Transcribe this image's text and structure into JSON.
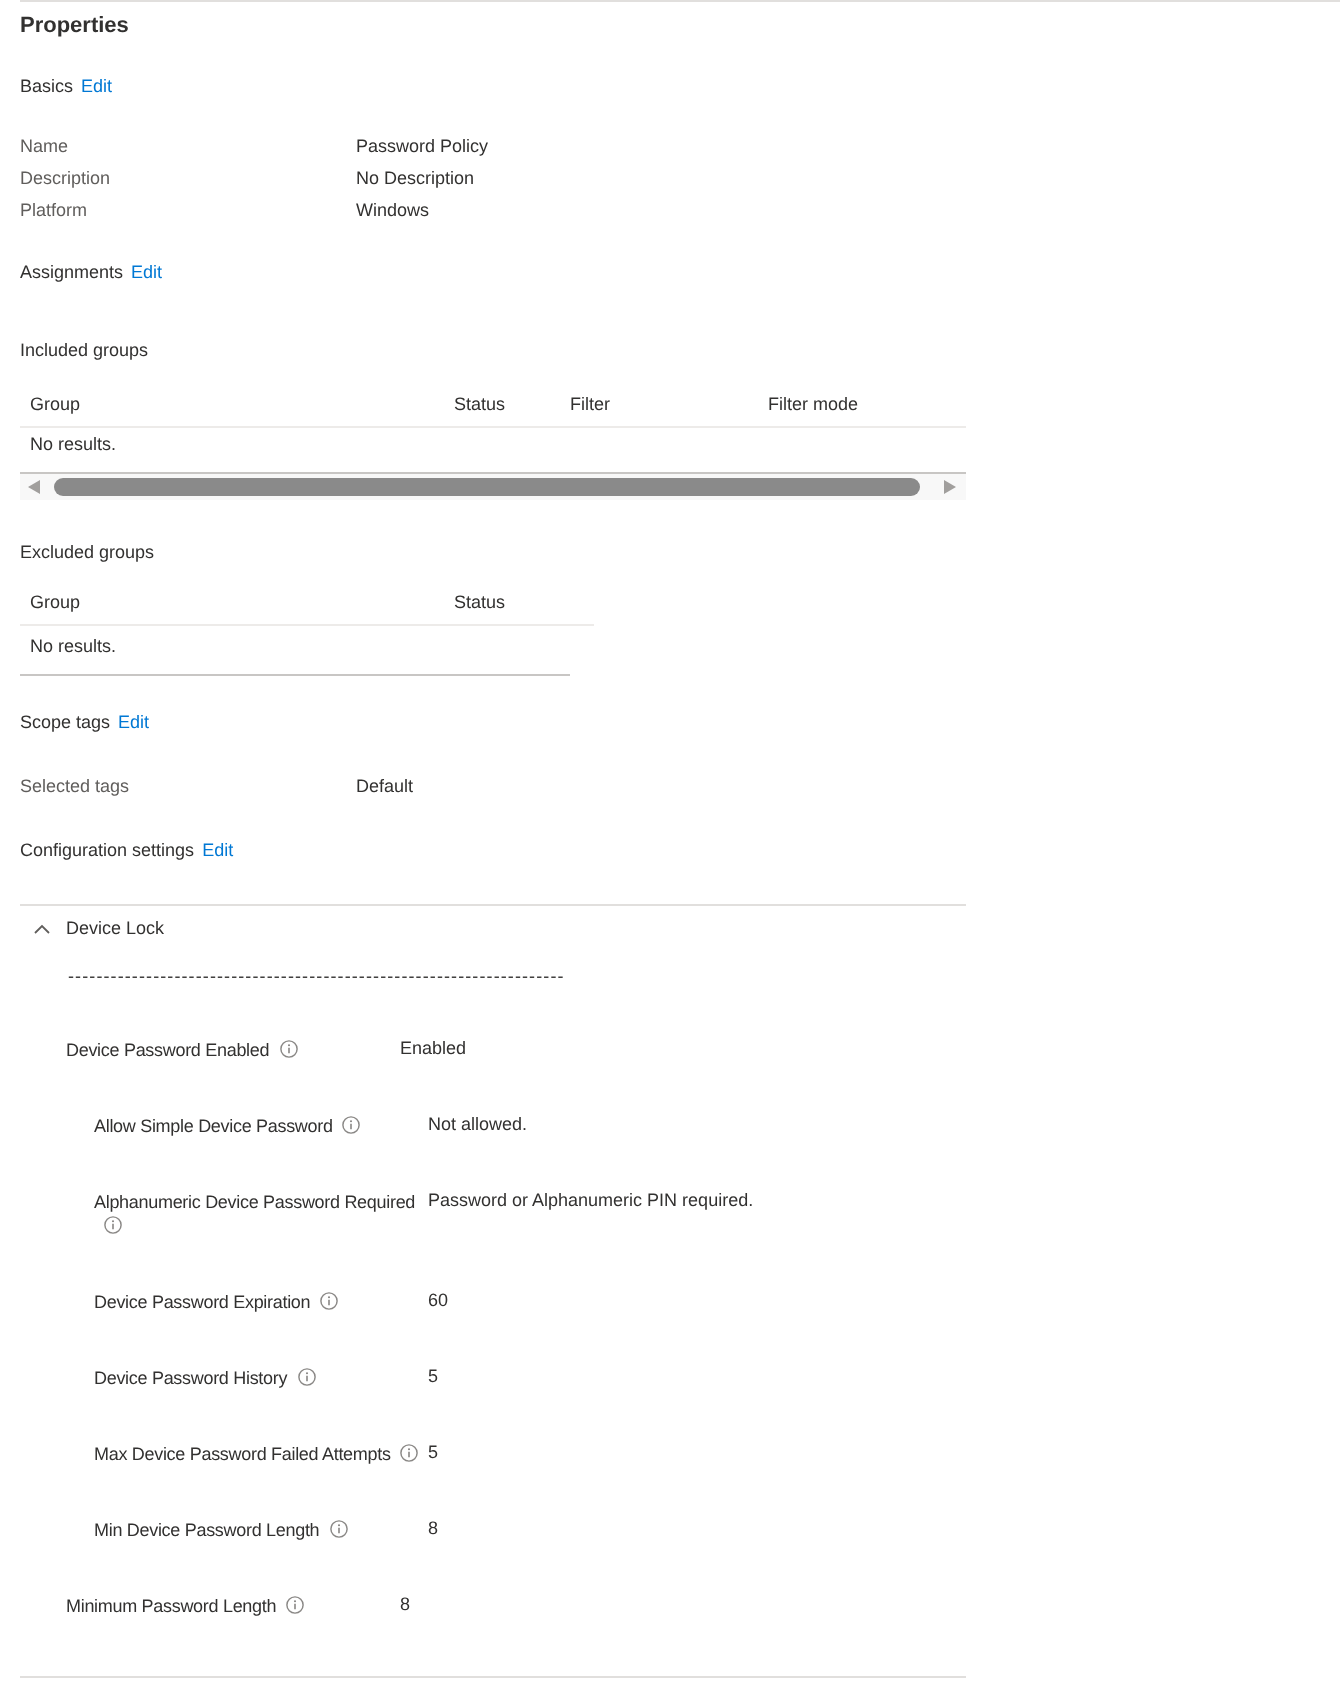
{
  "panel": {
    "title": "Properties"
  },
  "basics": {
    "heading": "Basics",
    "edit_link": "Edit",
    "fields": [
      {
        "label": "Name",
        "value": "Password Policy"
      },
      {
        "label": "Description",
        "value": "No Description"
      },
      {
        "label": "Platform",
        "value": "Windows"
      }
    ]
  },
  "assignments": {
    "heading": "Assignments",
    "edit_link": "Edit",
    "included_groups": {
      "heading": "Included groups",
      "columns": [
        "Group",
        "Status",
        "Filter",
        "Filter mode"
      ],
      "empty_message": "No results."
    },
    "excluded_groups": {
      "heading": "Excluded groups",
      "columns": [
        "Group",
        "Status"
      ],
      "empty_message": "No results."
    }
  },
  "scope_tags": {
    "heading": "Scope tags",
    "edit_link": "Edit",
    "fields": [
      {
        "label": "Selected tags",
        "value": "Default"
      }
    ]
  },
  "configuration_settings": {
    "heading": "Configuration settings",
    "edit_link": "Edit",
    "categories": [
      {
        "name": "Device Lock",
        "expanded": true,
        "separator": "----------------------------------------------------------------------",
        "settings": [
          {
            "label": "Device Password Enabled",
            "value": "Enabled",
            "children": [
              {
                "label": "Allow Simple Device Password",
                "value": "Not allowed."
              },
              {
                "label": "Alphanumeric Device Password Required",
                "value": "Password or Alphanumeric PIN required."
              },
              {
                "label": "Device Password Expiration",
                "value": "60"
              },
              {
                "label": "Device Password History",
                "value": "5"
              },
              {
                "label": "Max Device Password Failed Attempts",
                "value": "5"
              },
              {
                "label": "Min Device Password Length",
                "value": "8"
              }
            ]
          },
          {
            "label": "Minimum Password Length",
            "value": "8"
          }
        ]
      }
    ]
  }
}
